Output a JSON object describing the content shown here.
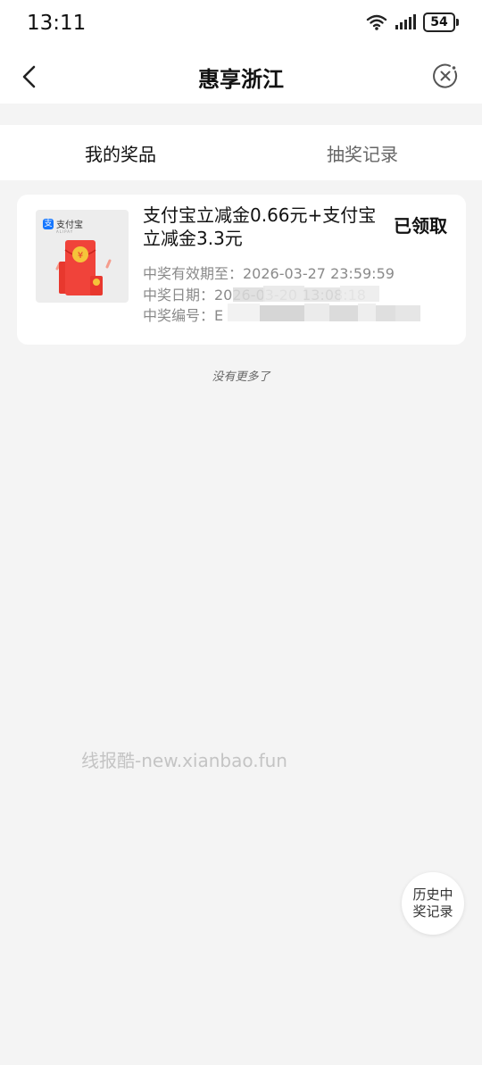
{
  "status_bar": {
    "time": "13:11",
    "battery": "54"
  },
  "nav": {
    "title": "惠享浙江"
  },
  "tabs": [
    {
      "label": "我的奖品"
    },
    {
      "label": "抽奖记录"
    }
  ],
  "prize": {
    "brand": "支付宝",
    "brand_sub": "ALIPAY",
    "title": "支付宝立减金0.66元+支付宝立减金3.3元",
    "status": "已领取",
    "expiry": "中奖有效期至：2026-03-27 23:59:59",
    "date": "中奖日期：2026-03-20 13:08:18",
    "number": "中奖编号：E"
  },
  "footer_text": "没有更多了",
  "watermark": "线报酷-new.xianbao.fun",
  "history_button": {
    "label": "历史中奖记录"
  },
  "colors": {
    "accent_blue": "#1677ff",
    "red_packet": "#f0433a",
    "gold": "#f5c43a"
  }
}
